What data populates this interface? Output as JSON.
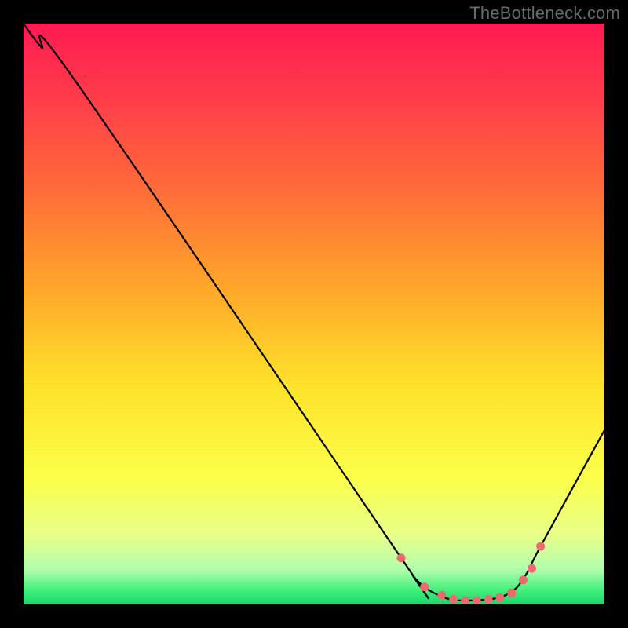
{
  "attribution": "TheBottleneck.com",
  "colors": {
    "frame": "#000000",
    "line": "#000000",
    "marker_fill": "#ee6a6f",
    "gradient_stops": [
      {
        "offset": 0.0,
        "color": "#ff1a52"
      },
      {
        "offset": 0.12,
        "color": "#ff3a4a"
      },
      {
        "offset": 0.28,
        "color": "#ff6a3a"
      },
      {
        "offset": 0.45,
        "color": "#ffa52a"
      },
      {
        "offset": 0.62,
        "color": "#ffe12a"
      },
      {
        "offset": 0.78,
        "color": "#fbff48"
      },
      {
        "offset": 0.88,
        "color": "#e8ff8a"
      },
      {
        "offset": 0.94,
        "color": "#b2ffad"
      },
      {
        "offset": 0.975,
        "color": "#44f07b"
      },
      {
        "offset": 1.0,
        "color": "#17d86c"
      }
    ]
  },
  "chart_data": {
    "type": "line",
    "title": "",
    "xlabel": "",
    "ylabel": "",
    "xlim": [
      0,
      100
    ],
    "ylim": [
      0,
      100
    ],
    "series": [
      {
        "name": "curve",
        "x": [
          0,
          3,
          9,
          65,
          67,
          69,
          71,
          73,
          75,
          77,
          79,
          81,
          83,
          85,
          87,
          89,
          100
        ],
        "y": [
          100,
          96,
          90,
          8,
          5,
          3,
          1.8,
          1,
          0.7,
          0.7,
          0.8,
          1,
          1.6,
          3,
          6,
          10,
          30
        ]
      }
    ],
    "markers": {
      "series": "curve",
      "x": [
        65,
        69,
        72,
        74,
        76,
        78,
        80,
        82,
        84,
        86,
        87.5,
        89
      ],
      "y": [
        8,
        3,
        1.6,
        0.9,
        0.7,
        0.7,
        0.9,
        1.2,
        2,
        4.2,
        6.2,
        10
      ]
    }
  }
}
